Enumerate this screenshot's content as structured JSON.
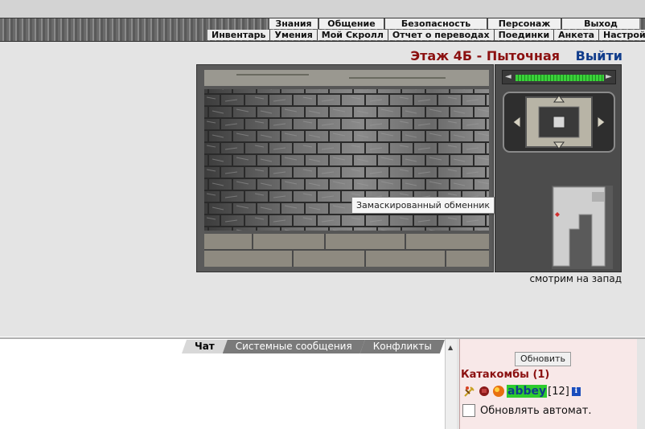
{
  "nav": {
    "main": [
      "Знания",
      "Общение",
      "Безопасность",
      "Персонаж",
      "Выход"
    ],
    "sub": [
      "Инвентарь",
      "Умения",
      "Мой Скролл",
      "Отчет о переводах",
      "Поединки",
      "Анкета",
      "Настройки"
    ]
  },
  "location": {
    "floor": "Этаж 4Б - Пыточная",
    "exit": "Выйти"
  },
  "scene": {
    "tooltip": "Замаскированный обменник",
    "facing": "смотрим на запад",
    "health_fraction": 1.0
  },
  "chat": {
    "tabs": [
      "Чат",
      "Системные сообщения",
      "Конфликты"
    ],
    "active_tab": "Чат"
  },
  "panel": {
    "refresh_label": "Обновить",
    "location_title": "Катакомбы (1)",
    "user": {
      "name": "abbey",
      "level": "[12]",
      "info": "i"
    },
    "auto_refresh_label": "Обновлять автомат.",
    "auto_refresh_checked": false
  },
  "colors": {
    "floor": "#8b1010",
    "exit": "#103c8b",
    "highlight": "#2ecc2e"
  }
}
